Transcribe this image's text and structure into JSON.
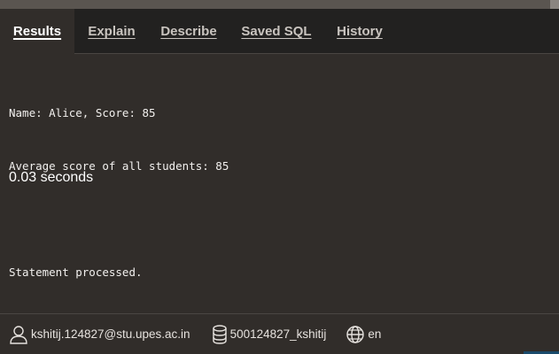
{
  "tabs": [
    {
      "label": "Results",
      "active": true
    },
    {
      "label": "Explain",
      "active": false
    },
    {
      "label": "Describe",
      "active": false
    },
    {
      "label": "Saved SQL",
      "active": false
    },
    {
      "label": "History",
      "active": false
    }
  ],
  "output": {
    "lines": [
      "Name: Alice, Score: 85",
      "Average score of all students: 85",
      "",
      "Statement processed."
    ],
    "timing": "0.03 seconds"
  },
  "footer": {
    "user": "kshitij.124827@stu.upes.ac.in",
    "user_icon": "user-icon",
    "schema": "500124827_kshitij",
    "schema_icon": "database-icon",
    "language": "en",
    "language_icon": "globe-icon"
  },
  "colors": {
    "background": "#312d2a",
    "tabbar": "#222120",
    "text": "#ffffff"
  }
}
